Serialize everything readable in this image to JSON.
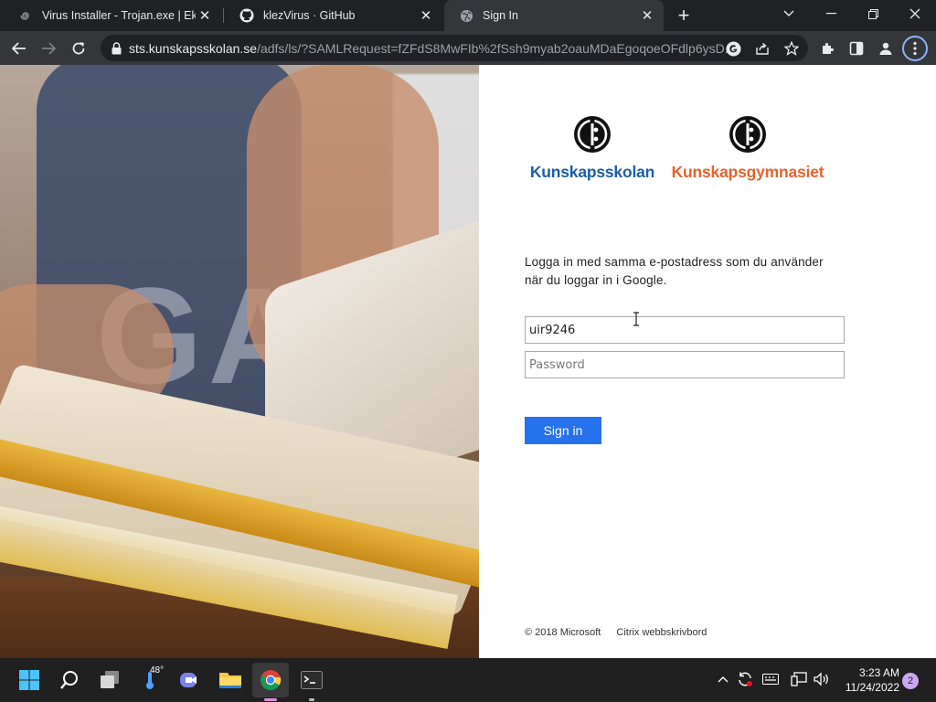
{
  "browser": {
    "tabs": [
      {
        "title": "Virus Installer - Trojan.exe | Ektop",
        "favicon": "spiral-icon"
      },
      {
        "title": "klezVirus · GitHub",
        "favicon": "github-icon"
      },
      {
        "title": "Sign In",
        "favicon": "globe-icon"
      }
    ],
    "address": {
      "host": "sts.kunskapsskolan.se",
      "path": "/adfs/ls/?SAMLRequest=fZFdS8MwFIb%2fSsh9myab2oauMDaEgoqoeOFdlp6ysD..."
    }
  },
  "page": {
    "logos": [
      {
        "name": "Kunskapsskolan",
        "color": "#1b5fa6"
      },
      {
        "name": "Kunskapsgymnasiet",
        "color": "#e8622c"
      }
    ],
    "intro_line1": "Logga in med samma e-postadress som du använder",
    "intro_line2": "när du loggar in i Google.",
    "username_value": "uir9246",
    "password_placeholder": "Password",
    "signin_label": "Sign in",
    "footer": {
      "copyright": "© 2018 Microsoft",
      "link": "Citrix webbskrivbord"
    },
    "hero_text": "GA"
  },
  "taskbar": {
    "weather": "48°",
    "time": "3:23 AM",
    "date": "11/24/2022",
    "notifications": "2"
  }
}
